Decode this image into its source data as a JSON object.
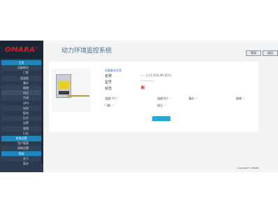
{
  "brand": {
    "name": "OMARA",
    "mark": "®"
  },
  "header": {
    "title": "动力环境监控系统",
    "btn_left": "登录",
    "btn_right": "退出"
  },
  "sidebar": {
    "items": [
      {
        "label": "主页",
        "type": "sect"
      },
      {
        "label": "设备概况",
        "type": "item"
      },
      {
        "label": "门禁",
        "type": "item"
      },
      {
        "label": "温湿度",
        "type": "item"
      },
      {
        "label": "漏水",
        "type": "item"
      },
      {
        "label": "烟感",
        "type": "item"
      },
      {
        "label": "电压",
        "type": "active"
      },
      {
        "label": "空调",
        "type": "item"
      },
      {
        "label": "UPS",
        "type": "item"
      },
      {
        "label": "电池",
        "type": "item"
      },
      {
        "label": "配电",
        "type": "item"
      },
      {
        "label": "红外",
        "type": "item"
      },
      {
        "label": "告警",
        "type": "item"
      },
      {
        "label": "视频",
        "type": "item"
      },
      {
        "label": "日志",
        "type": "item"
      },
      {
        "label": "系统设置",
        "type": "sect"
      },
      {
        "label": "用户管理",
        "type": "item"
      },
      {
        "label": "网络设置",
        "type": "item"
      },
      {
        "label": "帮助",
        "type": "sect"
      },
      {
        "label": "关于",
        "type": "item"
      },
      {
        "label": "版本",
        "type": "item"
      }
    ]
  },
  "device": {
    "section_title": "设备基本信息",
    "rows": [
      {
        "label": "名称",
        "value": "---- 1-21-03(LAN-001)"
      },
      {
        "label": "型号",
        "value": "-------------"
      },
      {
        "label": "状态",
        "value": "断"
      }
    ],
    "sensors": [
      {
        "label": "温度(℃)",
        "value": "--"
      },
      {
        "label": "湿度(%)",
        "value": "--"
      },
      {
        "label": "漏水",
        "value": "--"
      },
      {
        "label": "烟感",
        "value": "--"
      },
      {
        "label": "门磁",
        "value": "--"
      },
      {
        "label": "电压",
        "value": "--"
      }
    ],
    "apply_label": "确定"
  },
  "footer": {
    "text": "Copyright © OMARA"
  },
  "colors": {
    "sidebar": "#2b3a4f",
    "accent": "#1e86b8",
    "brand": "#e01b24"
  }
}
